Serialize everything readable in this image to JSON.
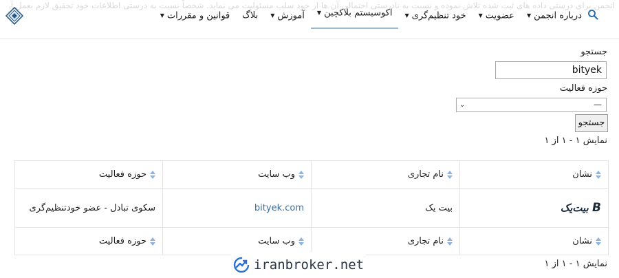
{
  "header": {
    "notice": "انجمن برای درستی داده های ثبت شده تلاش نموده و نسبت به نادرستی احتمالی آن ها از خود سلب مسئولیت می نماید. شخصاً نسبت به درستی اطلاعات خود تحقیق لازم بعمل آورید.",
    "nav_row1": [
      {
        "label": "درباره انجمن",
        "caret": true
      },
      {
        "label": "عضویت",
        "caret": true
      },
      {
        "label": "خود تنظیم‌گری",
        "caret": true
      },
      {
        "label": "اکوسیستم بلاکچین",
        "caret": true,
        "active": true
      }
    ],
    "nav_row2": [
      {
        "label": "آموزش",
        "caret": true
      },
      {
        "label": "بلاگ",
        "caret": false
      },
      {
        "label": "قوانین و مقررات",
        "caret": true
      }
    ]
  },
  "form": {
    "search_label": "جستجو",
    "search_value": "bityek",
    "field_label": "حوزه فعالیت",
    "select_value": "—",
    "submit_label": "جستجو"
  },
  "results_count_top": "نمایش ۱ - ۱ از ۱",
  "results_count_bottom": "نمایش ۱ - ۱ از ۱",
  "table": {
    "headers": [
      "نشان",
      "نام تجاری",
      "وب سایت",
      "حوزه فعالیت"
    ],
    "rows": [
      {
        "logo_text": "بیت‌یک",
        "name": "بیت یک",
        "website": "bityek.com",
        "activity": "سکوی تبادل - عضو خودتنظیم‌گری"
      }
    ]
  },
  "watermark": "iranbroker.net",
  "colors": {
    "link": "#3a6fa5",
    "active_underline": "#9bbad2",
    "sort_icon": "#8fb3d9"
  }
}
